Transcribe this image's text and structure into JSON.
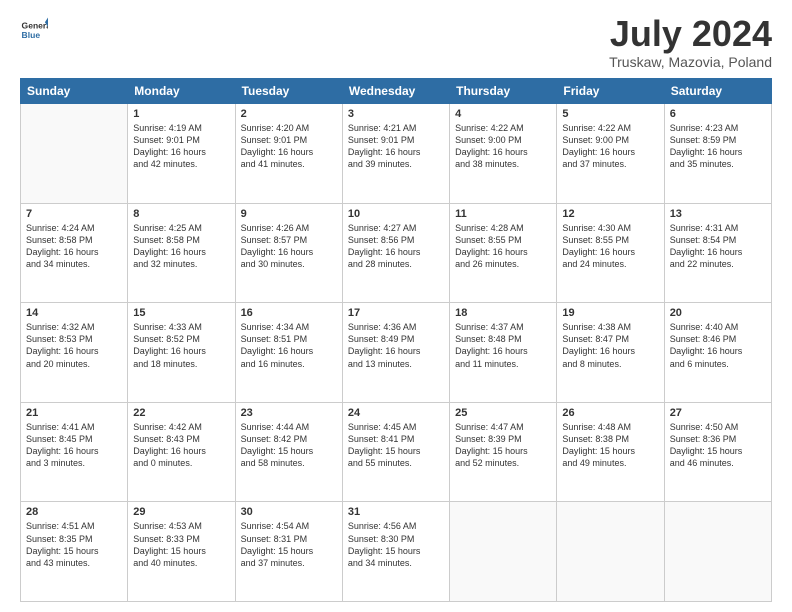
{
  "header": {
    "logo_line1": "General",
    "logo_line2": "Blue",
    "title": "July 2024",
    "location": "Truskaw, Mazovia, Poland"
  },
  "weekdays": [
    "Sunday",
    "Monday",
    "Tuesday",
    "Wednesday",
    "Thursday",
    "Friday",
    "Saturday"
  ],
  "weeks": [
    [
      {
        "day": "",
        "info": ""
      },
      {
        "day": "1",
        "info": "Sunrise: 4:19 AM\nSunset: 9:01 PM\nDaylight: 16 hours\nand 42 minutes."
      },
      {
        "day": "2",
        "info": "Sunrise: 4:20 AM\nSunset: 9:01 PM\nDaylight: 16 hours\nand 41 minutes."
      },
      {
        "day": "3",
        "info": "Sunrise: 4:21 AM\nSunset: 9:01 PM\nDaylight: 16 hours\nand 39 minutes."
      },
      {
        "day": "4",
        "info": "Sunrise: 4:22 AM\nSunset: 9:00 PM\nDaylight: 16 hours\nand 38 minutes."
      },
      {
        "day": "5",
        "info": "Sunrise: 4:22 AM\nSunset: 9:00 PM\nDaylight: 16 hours\nand 37 minutes."
      },
      {
        "day": "6",
        "info": "Sunrise: 4:23 AM\nSunset: 8:59 PM\nDaylight: 16 hours\nand 35 minutes."
      }
    ],
    [
      {
        "day": "7",
        "info": "Sunrise: 4:24 AM\nSunset: 8:58 PM\nDaylight: 16 hours\nand 34 minutes."
      },
      {
        "day": "8",
        "info": "Sunrise: 4:25 AM\nSunset: 8:58 PM\nDaylight: 16 hours\nand 32 minutes."
      },
      {
        "day": "9",
        "info": "Sunrise: 4:26 AM\nSunset: 8:57 PM\nDaylight: 16 hours\nand 30 minutes."
      },
      {
        "day": "10",
        "info": "Sunrise: 4:27 AM\nSunset: 8:56 PM\nDaylight: 16 hours\nand 28 minutes."
      },
      {
        "day": "11",
        "info": "Sunrise: 4:28 AM\nSunset: 8:55 PM\nDaylight: 16 hours\nand 26 minutes."
      },
      {
        "day": "12",
        "info": "Sunrise: 4:30 AM\nSunset: 8:55 PM\nDaylight: 16 hours\nand 24 minutes."
      },
      {
        "day": "13",
        "info": "Sunrise: 4:31 AM\nSunset: 8:54 PM\nDaylight: 16 hours\nand 22 minutes."
      }
    ],
    [
      {
        "day": "14",
        "info": "Sunrise: 4:32 AM\nSunset: 8:53 PM\nDaylight: 16 hours\nand 20 minutes."
      },
      {
        "day": "15",
        "info": "Sunrise: 4:33 AM\nSunset: 8:52 PM\nDaylight: 16 hours\nand 18 minutes."
      },
      {
        "day": "16",
        "info": "Sunrise: 4:34 AM\nSunset: 8:51 PM\nDaylight: 16 hours\nand 16 minutes."
      },
      {
        "day": "17",
        "info": "Sunrise: 4:36 AM\nSunset: 8:49 PM\nDaylight: 16 hours\nand 13 minutes."
      },
      {
        "day": "18",
        "info": "Sunrise: 4:37 AM\nSunset: 8:48 PM\nDaylight: 16 hours\nand 11 minutes."
      },
      {
        "day": "19",
        "info": "Sunrise: 4:38 AM\nSunset: 8:47 PM\nDaylight: 16 hours\nand 8 minutes."
      },
      {
        "day": "20",
        "info": "Sunrise: 4:40 AM\nSunset: 8:46 PM\nDaylight: 16 hours\nand 6 minutes."
      }
    ],
    [
      {
        "day": "21",
        "info": "Sunrise: 4:41 AM\nSunset: 8:45 PM\nDaylight: 16 hours\nand 3 minutes."
      },
      {
        "day": "22",
        "info": "Sunrise: 4:42 AM\nSunset: 8:43 PM\nDaylight: 16 hours\nand 0 minutes."
      },
      {
        "day": "23",
        "info": "Sunrise: 4:44 AM\nSunset: 8:42 PM\nDaylight: 15 hours\nand 58 minutes."
      },
      {
        "day": "24",
        "info": "Sunrise: 4:45 AM\nSunset: 8:41 PM\nDaylight: 15 hours\nand 55 minutes."
      },
      {
        "day": "25",
        "info": "Sunrise: 4:47 AM\nSunset: 8:39 PM\nDaylight: 15 hours\nand 52 minutes."
      },
      {
        "day": "26",
        "info": "Sunrise: 4:48 AM\nSunset: 8:38 PM\nDaylight: 15 hours\nand 49 minutes."
      },
      {
        "day": "27",
        "info": "Sunrise: 4:50 AM\nSunset: 8:36 PM\nDaylight: 15 hours\nand 46 minutes."
      }
    ],
    [
      {
        "day": "28",
        "info": "Sunrise: 4:51 AM\nSunset: 8:35 PM\nDaylight: 15 hours\nand 43 minutes."
      },
      {
        "day": "29",
        "info": "Sunrise: 4:53 AM\nSunset: 8:33 PM\nDaylight: 15 hours\nand 40 minutes."
      },
      {
        "day": "30",
        "info": "Sunrise: 4:54 AM\nSunset: 8:31 PM\nDaylight: 15 hours\nand 37 minutes."
      },
      {
        "day": "31",
        "info": "Sunrise: 4:56 AM\nSunset: 8:30 PM\nDaylight: 15 hours\nand 34 minutes."
      },
      {
        "day": "",
        "info": ""
      },
      {
        "day": "",
        "info": ""
      },
      {
        "day": "",
        "info": ""
      }
    ]
  ]
}
